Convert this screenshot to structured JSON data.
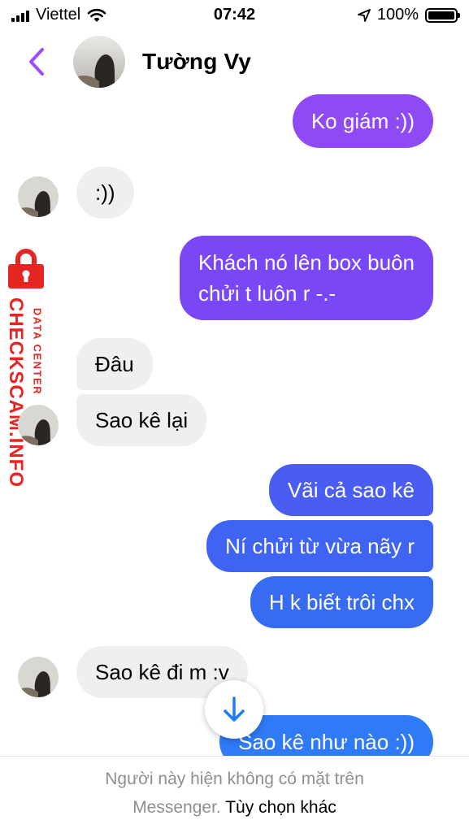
{
  "status_bar": {
    "carrier": "Viettel",
    "time": "07:42",
    "battery_percent": "100%",
    "battery_level": 1.0,
    "signal_icon": "signal-bars-icon",
    "wifi_icon": "wifi-icon",
    "location_icon": "location-arrow-icon"
  },
  "header": {
    "contact_name": "Tường Vy",
    "back_icon": "chevron-left-icon",
    "accent_color": "#9b4dfb"
  },
  "messages": [
    {
      "id": 1,
      "side": "out",
      "lines": [
        "Ko giám :))"
      ],
      "color": "#8f49f5"
    },
    {
      "id": 2,
      "side": "in",
      "lines": [
        ":))"
      ]
    },
    {
      "id": 3,
      "side": "out",
      "lines": [
        "Khách nó lên box buôn",
        "chửi t luôn r -.-"
      ],
      "color": "#7a47f6"
    },
    {
      "id": 4,
      "side": "in",
      "lines": [
        "Đâu"
      ]
    },
    {
      "id": 5,
      "side": "in",
      "lines": [
        "Sao kê lại"
      ]
    },
    {
      "id": 6,
      "side": "out",
      "lines": [
        "Vãi cả sao kê"
      ],
      "color": "#4a5df3"
    },
    {
      "id": 7,
      "side": "out",
      "lines": [
        "Ní chửi từ vừa nãy r"
      ],
      "color": "#3f63f3"
    },
    {
      "id": 8,
      "side": "out",
      "lines": [
        "H k biết trôi chx"
      ],
      "color": "#366bf2"
    },
    {
      "id": 9,
      "side": "in",
      "lines": [
        "Sao kê đi m :v"
      ]
    },
    {
      "id": 10,
      "side": "out",
      "lines": [
        "Sao kê như nào :))"
      ],
      "color": "#2f7af6"
    }
  ],
  "watermark": {
    "main": "CHECKSCAM.INFO",
    "sub": "DATA CENTER",
    "color": "#e52521",
    "icon": "padlock-icon"
  },
  "scroll_button": {
    "icon": "arrow-down-icon",
    "color": "#1f7cf5"
  },
  "footer": {
    "line1": "Người này hiện không có mặt trên",
    "line2_muted": "Messenger.",
    "line2_link": "Tùy chọn khác"
  }
}
